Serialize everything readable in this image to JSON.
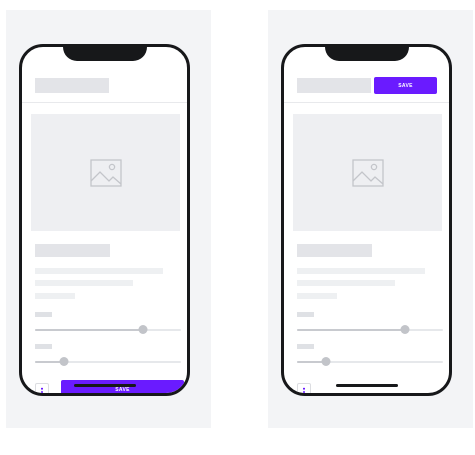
{
  "screens": [
    {
      "variant": "bottom-save",
      "save_label": "SAVE",
      "sliders": [
        {
          "level": 0.74
        },
        {
          "level": 0.2
        }
      ]
    },
    {
      "variant": "top-save",
      "save_label": "SAVE",
      "sliders": [
        {
          "level": 0.74
        },
        {
          "level": 0.2
        }
      ]
    }
  ],
  "icons": {
    "image_placeholder": "image-icon",
    "more": "more-vertical-icon"
  },
  "colors": {
    "accent": "#6a1bff",
    "frame": "#17181a",
    "panel_background": "#f3f4f6",
    "placeholder": "#e3e4e8"
  }
}
